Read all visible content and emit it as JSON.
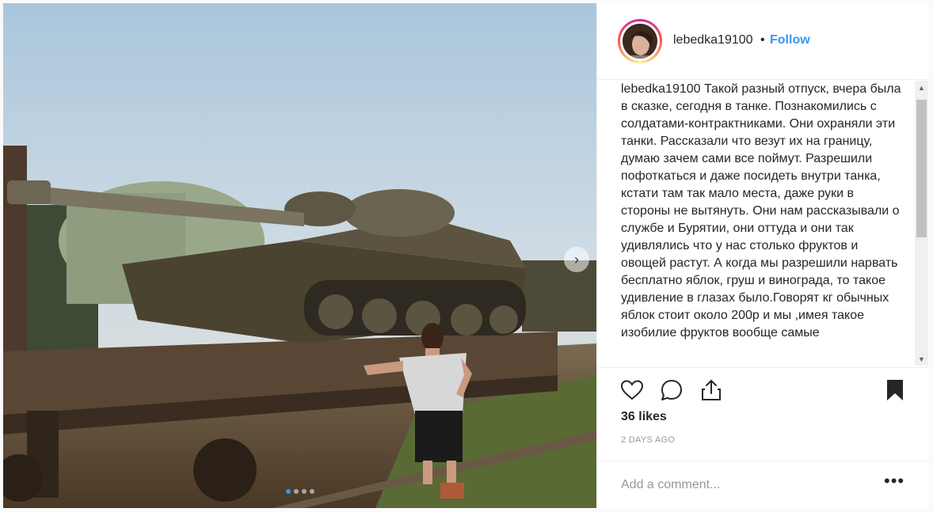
{
  "post": {
    "username": "lebedka19100",
    "separator": "•",
    "follow_label": "Follow",
    "caption_user": "lebedka19100",
    "caption_text": "Такой разный отпуск, вчера была в сказке, сегодня в танке. Познакомились с солдатами-контрактниками. Они охраняли эти танки. Рассказали что везут их на границу, думаю зачем сами все поймут. Разрешили пофоткаться и даже посидеть внутри танка, кстати там так мало места, даже руки в стороны не вытянуть. Они нам рассказывали о службе и Бурятии, они оттуда и они так удивлялись что у нас столько фруктов и овощей растут. А когда мы разрешили нарвать бесплатно яблок, груш и винограда, то такое удивление в глазах было.Говорят кг обычных яблок стоит около 200р и мы ,имея такое изобилие фруктов вообще самые",
    "likes": "36 likes",
    "date": "2 DAYS AGO",
    "comment_placeholder": "Add a comment...",
    "more_label": "•••"
  },
  "carousel": {
    "dots": 4,
    "active": 0,
    "next_icon": "chevron-right-icon"
  },
  "icons": {
    "like": "heart-icon",
    "comment": "comment-bubble-icon",
    "share": "share-upload-icon",
    "save": "bookmark-icon"
  },
  "colors": {
    "accent": "#3897f0",
    "text": "#262626",
    "muted": "#999999",
    "border": "#efefef"
  }
}
